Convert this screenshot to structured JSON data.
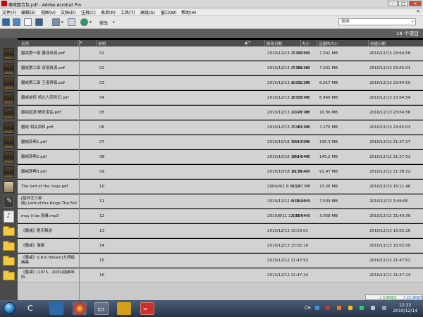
{
  "window": {
    "title": "魔戒整合包.pdf - Adobe Acrobat Pro",
    "minimize": "–",
    "maximize": "□",
    "close": "✕"
  },
  "menu": {
    "items": [
      "文件(F)",
      "编辑(E)",
      "视图(V)",
      "文档(D)",
      "注释(C)",
      "表单(R)",
      "工具(T)",
      "高级(A)",
      "窗口(W)",
      "帮助(H)"
    ],
    "close": "×"
  },
  "toolbar": {
    "edit_label": "修改",
    "search_placeholder": "搜索",
    "search_icon": "search-icon"
  },
  "count": "16 个项目",
  "columns": {
    "name": "名称",
    "x": "X",
    "desc": "说明",
    "y": "Y",
    "modified": "修改日期",
    "size": "大小",
    "compressed": "压缩的大小",
    "created": "创建日期"
  },
  "rows": [
    {
      "type": "pdf",
      "name": "魔戒第一部 魔戒出现.pdf",
      "desc": "01",
      "mod": "2010/12/13 21:54:51",
      "size": "7.240 MB",
      "csize": "7.241 MB",
      "created": "2010/12/13 23:64:58"
    },
    {
      "type": "pdf",
      "name": "魔戒第二部 双塔奇谋.pdf",
      "desc": "02",
      "mod": "2010/12/13 21:59:26",
      "size": "7.180 MB",
      "csize": "7.041 MB",
      "created": "2010/12/13 23:65:01"
    },
    {
      "type": "pdf",
      "name": "魔戒第三部 王者再临.pdf",
      "desc": "03",
      "mod": "2010/12/13 22:01:20",
      "size": "6.012 MB",
      "csize": "6.017 MB",
      "created": "2010/12/13 23:64:59"
    },
    {
      "type": "pdf",
      "name": "魔戒前传 哈比人历险记.pdf",
      "desc": "04",
      "mod": "2010/12/13 22:12:34",
      "size": "8.539 MB",
      "csize": "8.466 MB",
      "created": "2010/12/13 23:64:54"
    },
    {
      "type": "pdf",
      "name": "魔戒起源 精灵宝钻.pdf",
      "desc": "05",
      "mod": "2010/12/13 22:23:18",
      "size": "10.47 MB",
      "csize": "10.36 MB",
      "created": "2010/12/13 23:64:56"
    },
    {
      "type": "pdf",
      "name": "魔戒 相关资料.pdf",
      "desc": "06",
      "mod": "2010/12/13 22:30:33",
      "size": "7.282 MB",
      "csize": "7.275 MB",
      "created": "2010/12/13 23:65:03"
    },
    {
      "type": "pdf",
      "name": "魔戒辞典1.pdf",
      "desc": "07",
      "mod": "2010/10/18 15:13:04",
      "size": "139.7 MB",
      "csize": "135.3 MB",
      "created": "2010/12/12 21:37:27"
    },
    {
      "type": "pdf",
      "name": "魔戒辞典2.pdf",
      "desc": "08",
      "mod": "2010/10/18 16:14:44",
      "size": "148.8 MB",
      "csize": "145.2 MB",
      "created": "2010/12/12 21:37:53"
    },
    {
      "type": "pdf",
      "name": "魔戒辞典3.pdf",
      "desc": "09",
      "mod": "2010/10/18 15:39:41",
      "size": "91.80 MB",
      "csize": "91.47 MB",
      "created": "2010/12/12 21:38:22"
    },
    {
      "type": "pdf-light",
      "name": "The lord of the rings.pdf",
      "desc": "10",
      "mod": "2004/4/2 9:36:28",
      "size": "13.67 MB",
      "csize": "13.26 MB",
      "created": "2010/12/13 15:11:46"
    },
    {
      "type": "tool",
      "name": "[指环王三部曲].Lord.of.the.Rings.The.Fell",
      "desc": "11",
      "mod": "2010/12/12 0:18:26",
      "size": "9.994 MB",
      "csize": "7.539 MB",
      "created": "2010/12/13 3:49:06"
    },
    {
      "type": "audio",
      "name": "may it be-恩雅.mp3",
      "desc": "12",
      "mod": "2010/8/11 22:03:54",
      "size": "3.899 MB",
      "csize": "3.058 MB",
      "created": "2010/12/12 21:40:39"
    },
    {
      "type": "folder",
      "name": "《魔戒》剧乐精选",
      "desc": "13",
      "mod": "2010/12/13 15:03:01",
      "size": "",
      "csize": "",
      "created": "2010/12/13 15:02:26"
    },
    {
      "type": "folder",
      "name": "《魔戒》海报",
      "desc": "14",
      "mod": "2010/12/13 15:02:10",
      "size": "",
      "csize": "",
      "created": "2010/12/13 15:02:09"
    },
    {
      "type": "folder",
      "name": "《魔戒》(J.R.R.Tolkien)大师插画集",
      "desc": "15",
      "mod": "2010/12/12 21:47:52",
      "size": "",
      "csize": "",
      "created": "2010/12/12 21:47:52"
    },
    {
      "type": "folder",
      "name": "《魔戒》(1975...2001)插画年历",
      "desc": "16",
      "mod": "2010/12/12 21:47:24",
      "size": "",
      "csize": "",
      "created": "2010/12/12 21:47:24"
    }
  ],
  "netmeter": {
    "down": "↓ 0.8KB/S",
    "up": "↑ 22.9KB/S"
  },
  "taskbar": {
    "ime": "CH",
    "time": "12:22",
    "date": "2010/12/14"
  }
}
